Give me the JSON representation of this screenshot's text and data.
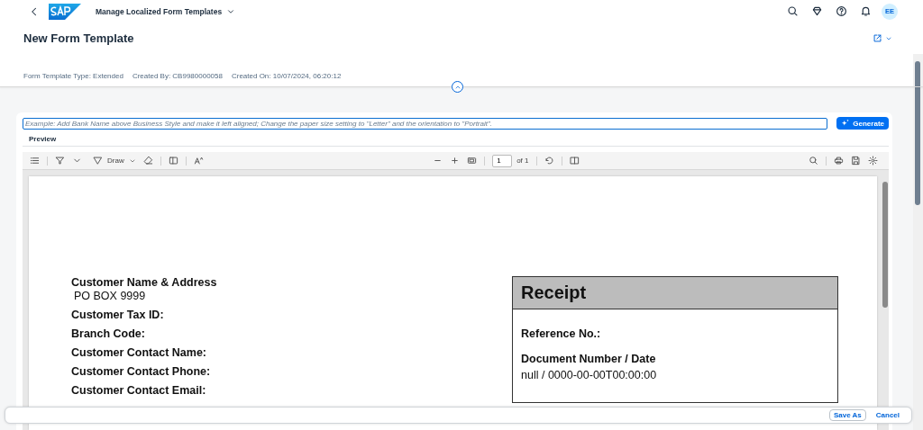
{
  "shell": {
    "app_title": "Manage Localized Form Templates",
    "avatar": "EE"
  },
  "header": {
    "title": "New Form Template",
    "attributes": [
      {
        "label": "Form Template Type:",
        "value": "Extended"
      },
      {
        "label": "Created By:",
        "value": "CB9980000058"
      },
      {
        "label": "Created On:",
        "value": "10/07/2024, 06:20:12"
      }
    ]
  },
  "prompt": {
    "placeholder": "Example: Add Bank Name above Business Style and make it left aligned; Change the paper size setting to \"Letter\" and the orientation to \"Portrait\".",
    "button": "Generate"
  },
  "preview": {
    "label": "Preview",
    "toolbar": {
      "draw": "Draw",
      "page": "1",
      "page_count": "of 1"
    },
    "document": {
      "left_fields": [
        {
          "label": "Customer Name & Address",
          "value": "PO BOX 9999"
        },
        {
          "label": "Customer Tax ID:"
        },
        {
          "label": "Branch Code:"
        },
        {
          "label": "Customer Contact Name:"
        },
        {
          "label": "Customer Contact Phone:"
        },
        {
          "label": "Customer Contact Email:"
        }
      ],
      "receipt": {
        "title": "Receipt",
        "fields": [
          {
            "label": "Reference No.:"
          },
          {
            "label": "Document Number / Date",
            "value": "null / 0000-00-00T00:00:00"
          }
        ]
      }
    }
  },
  "footer": {
    "buttons": [
      {
        "label": "Save As",
        "kind": "outlined"
      },
      {
        "label": "Cancel",
        "kind": "transparent"
      }
    ]
  }
}
